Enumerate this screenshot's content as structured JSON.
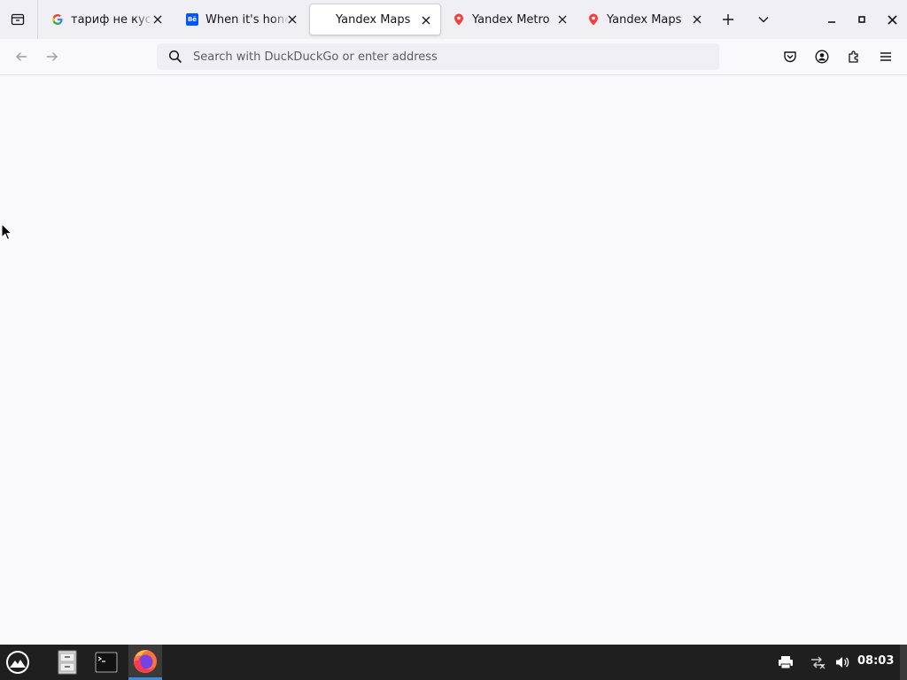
{
  "tabs": [
    {
      "title": "тариф не кусается",
      "favicon": "google-icon",
      "active": false
    },
    {
      "title": "When it's honest",
      "favicon": "behance-icon",
      "favicon_text": "Bē",
      "active": false
    },
    {
      "title": "Yandex Maps",
      "favicon": "none",
      "active": true
    },
    {
      "title": "Yandex Metro",
      "favicon": "yandex-pin-icon",
      "active": false
    },
    {
      "title": "Yandex Maps",
      "favicon": "yandex-pin-icon",
      "active": false
    }
  ],
  "urlbar": {
    "placeholder": "Search with DuckDuckGo or enter address",
    "value": ""
  },
  "taskbar": {
    "clock": "08:03"
  },
  "colors": {
    "accent": "#3d8bd8",
    "yandex_pin": "#f43f3f",
    "behance": "#0057ff",
    "taskbar_bg": "#1f1f1f"
  }
}
